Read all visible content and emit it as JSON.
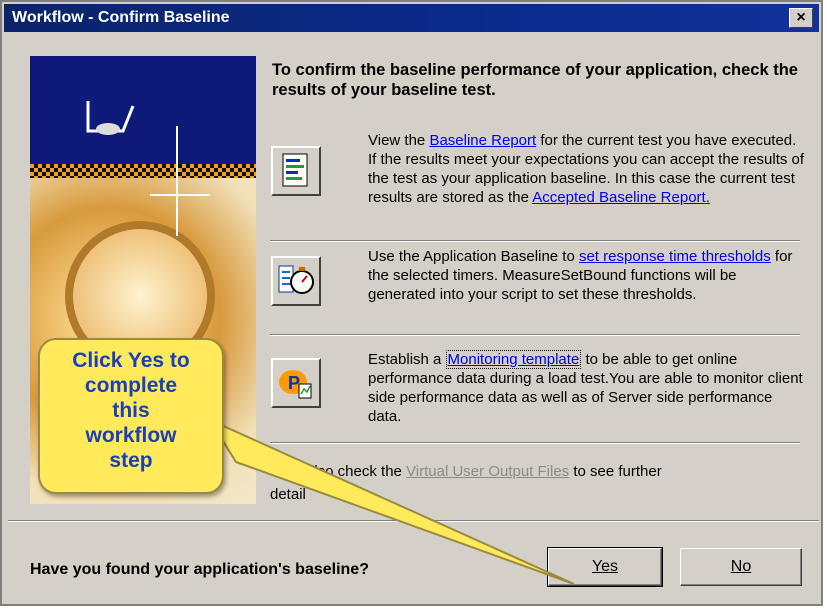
{
  "window": {
    "title": "Workflow - Confirm Baseline",
    "close_label": "×"
  },
  "heading": "To confirm the baseline performance of your application, check the results of your baseline test.",
  "items": [
    {
      "icon": "report-document-icon",
      "text_before": "View the ",
      "link": "Baseline Report",
      "text_after": " for the current test you have executed. If the results meet your expectations you can accept the results of the test as your application baseline. In this case the current test results are stored as the ",
      "link2": "Accepted Baseline Report."
    },
    {
      "icon": "stopwatch-thresholds-icon",
      "text_before": "Use the Application Baseline to ",
      "link": "set response time thresholds",
      "text_after": " for the selected timers. MeasureSetBound functions will be generated into your script to set these thresholds."
    },
    {
      "icon": "monitoring-icon",
      "text_before": "Establish a ",
      "link": "Monitoring template",
      "text_after": " to be able to get online performance data during a load test.You are able to monitor client side performance data as well as of Server side performance data."
    },
    {
      "text_visible_start": "also check the ",
      "link": "Virtual User Output Files",
      "text_after": " to see further",
      "text_line2": "detail"
    }
  ],
  "question": "Have you found your application's baseline?",
  "buttons": {
    "yes": "Yes",
    "no": "No"
  },
  "callout": {
    "lines": [
      "Click Yes to",
      "complete",
      "this",
      "workflow",
      "step"
    ]
  },
  "colors": {
    "titlebar": "#0a246a",
    "callout": "#ffea5c",
    "callout_text": "#1a3fb8",
    "link": "#0000ee"
  }
}
